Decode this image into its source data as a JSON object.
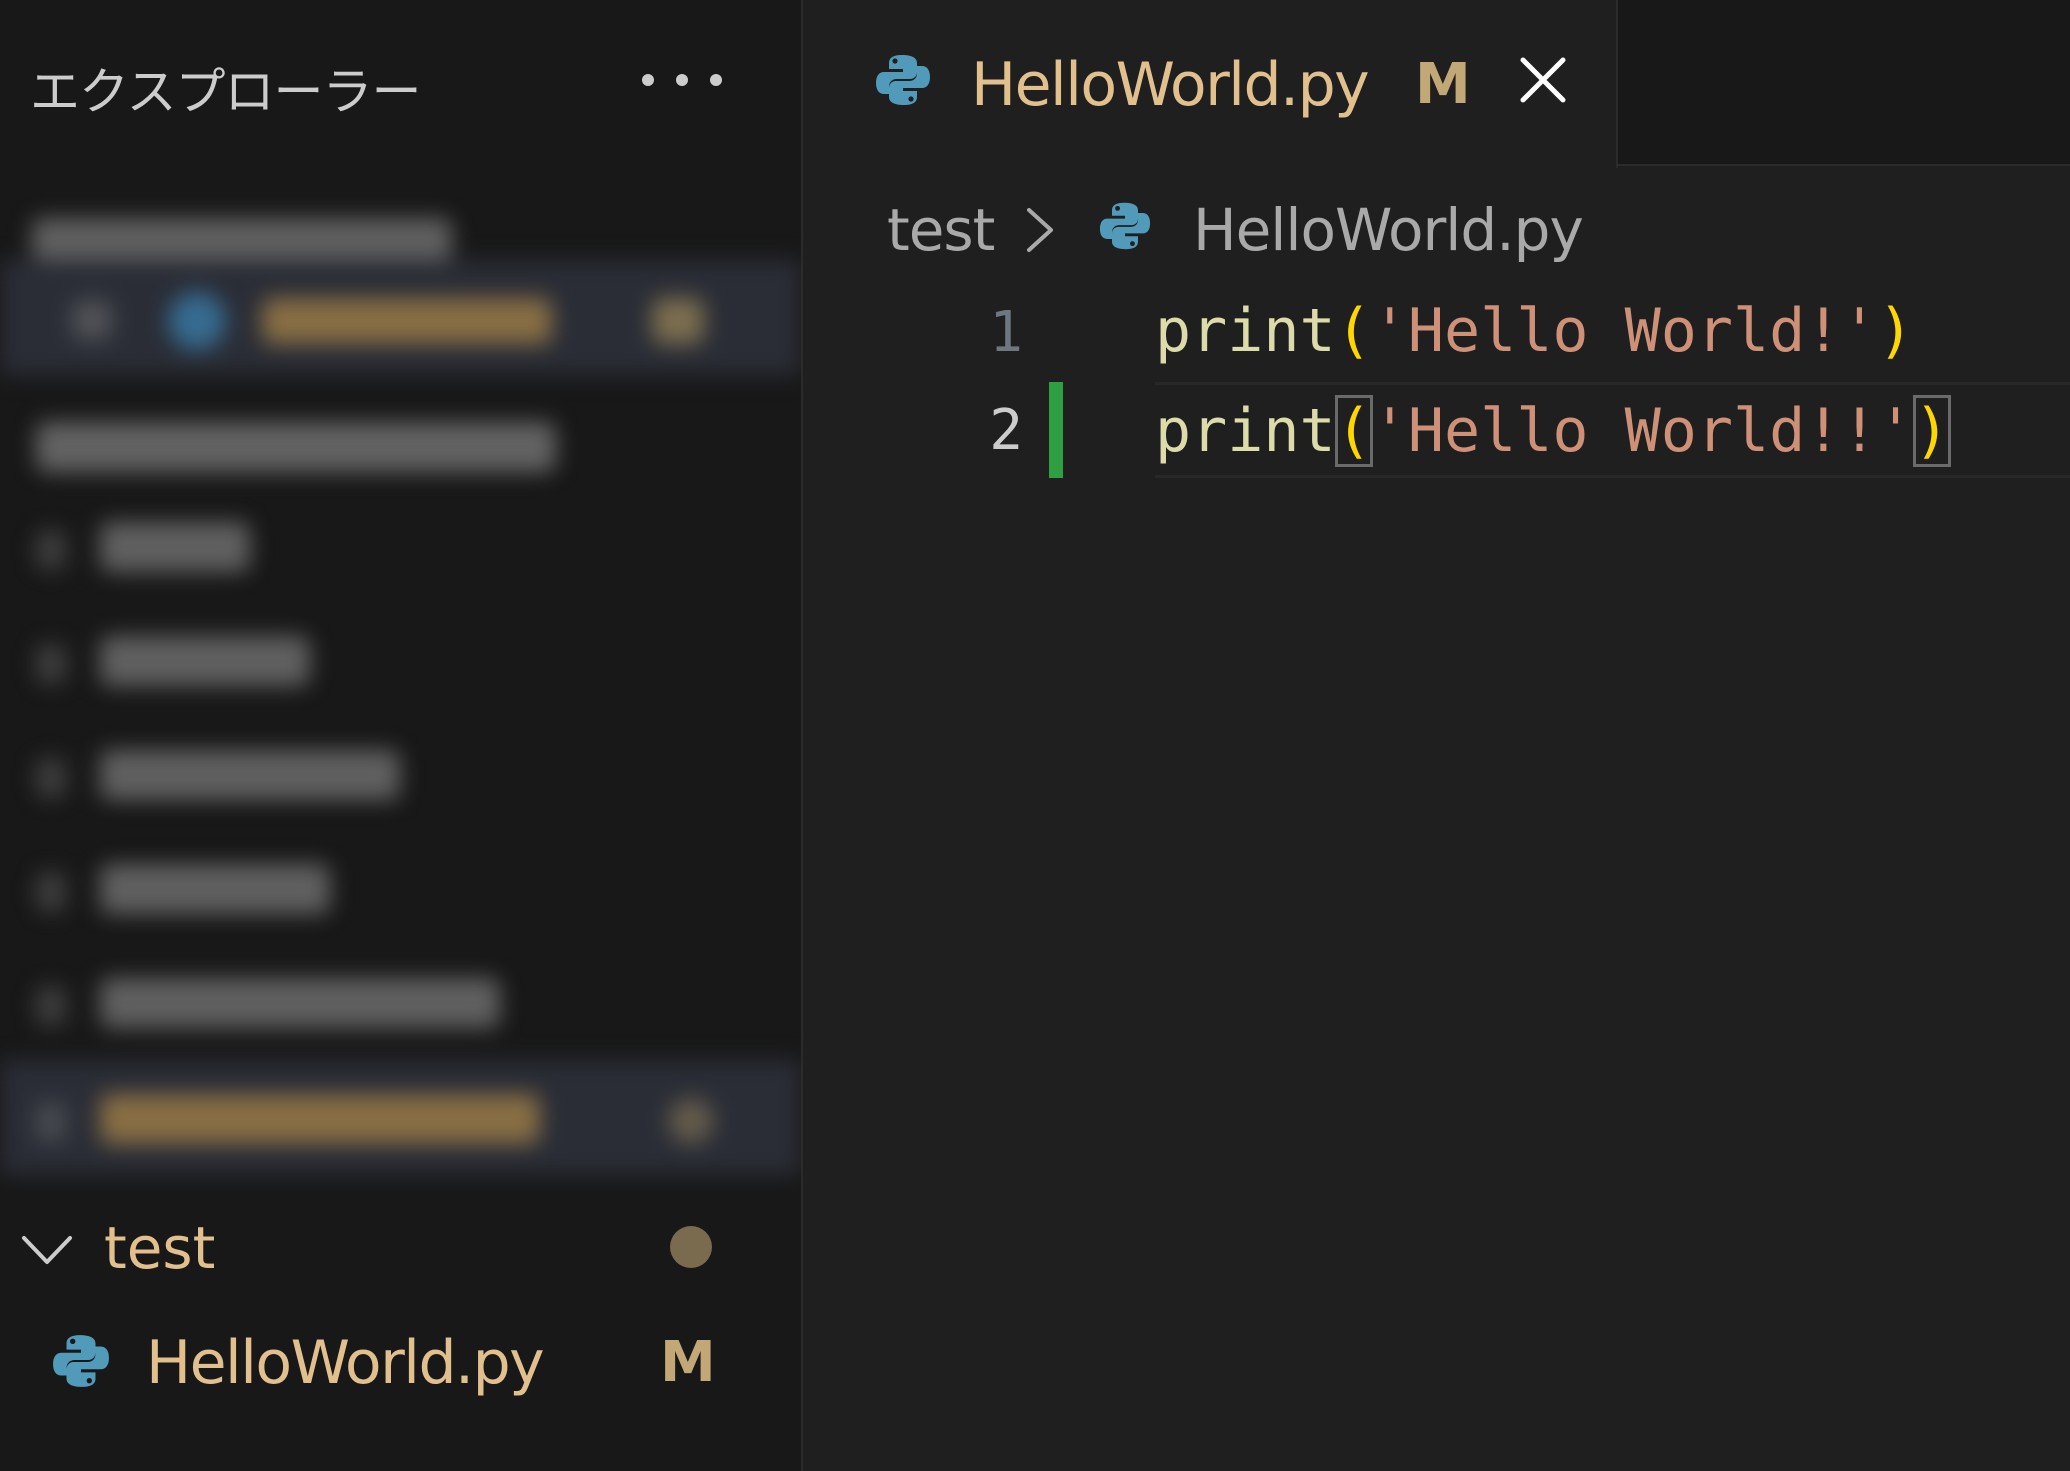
{
  "sidebar": {
    "title": "エクスプローラー",
    "more_icon": "ellipsis-icon",
    "folder": {
      "name": "test",
      "expanded": true,
      "status_dot_color": "#7a6b4f"
    },
    "file": {
      "name": "HelloWorld.py",
      "badge": "M",
      "icon": "python-icon"
    }
  },
  "editor": {
    "tab": {
      "label": "HelloWorld.py",
      "badge": "M",
      "icon": "python-icon",
      "close_icon": "close-icon"
    },
    "breadcrumb": {
      "folder": "test",
      "file": "HelloWorld.py"
    },
    "lines": [
      {
        "number": "1",
        "fn": "print",
        "open": "(",
        "str": "'Hello World!'",
        "close": ")"
      },
      {
        "number": "2",
        "fn": "print",
        "open": "(",
        "str": "'Hello World!!'",
        "close": ")"
      }
    ]
  },
  "colors": {
    "modified": "#e2c08d",
    "added_gutter": "#2ea043",
    "python_blue": "#519aba",
    "string": "#ce9178",
    "function": "#dcdcaa",
    "bracket": "#ffd700"
  }
}
